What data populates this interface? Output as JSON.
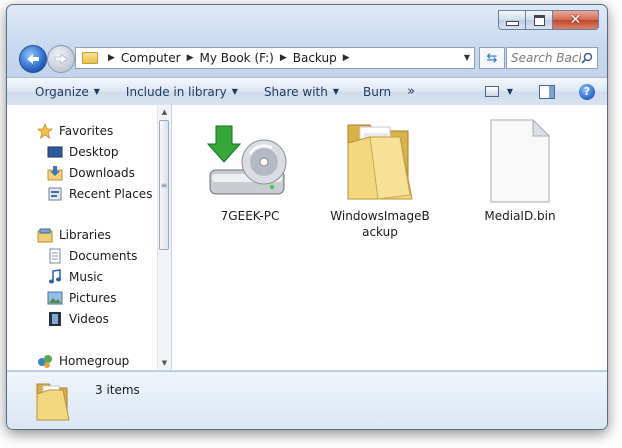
{
  "window": {
    "caption_buttons": [
      "minimize",
      "maximize",
      "close"
    ]
  },
  "nav": {
    "back_icon": "back-arrow-icon",
    "forward_icon": "forward-arrow-icon"
  },
  "address": {
    "crumbs": [
      "Computer",
      "My Book (F:)",
      "Backup"
    ]
  },
  "search": {
    "placeholder": "Search Back..."
  },
  "toolbar": {
    "organize": "Organize",
    "include_in_library": "Include in library",
    "share_with": "Share with",
    "burn": "Burn",
    "more": "»"
  },
  "sidebar": {
    "favorites": {
      "label": "Favorites",
      "items": [
        "Desktop",
        "Downloads",
        "Recent Places"
      ]
    },
    "libraries": {
      "label": "Libraries",
      "items": [
        "Documents",
        "Music",
        "Pictures",
        "Videos"
      ]
    },
    "homegroup": {
      "label": "Homegroup"
    }
  },
  "files": [
    {
      "name": "7GEEK-PC",
      "icon": "backup-drive-icon"
    },
    {
      "name": "WindowsImageBackup",
      "icon": "folder-icon"
    },
    {
      "name": "MediaID.bin",
      "icon": "file-icon"
    }
  ],
  "details": {
    "count": "3 items"
  },
  "colors": {
    "window_chrome": "#c9daf0",
    "toolbar_text": "#1e395b",
    "accent": "#2463c5"
  }
}
